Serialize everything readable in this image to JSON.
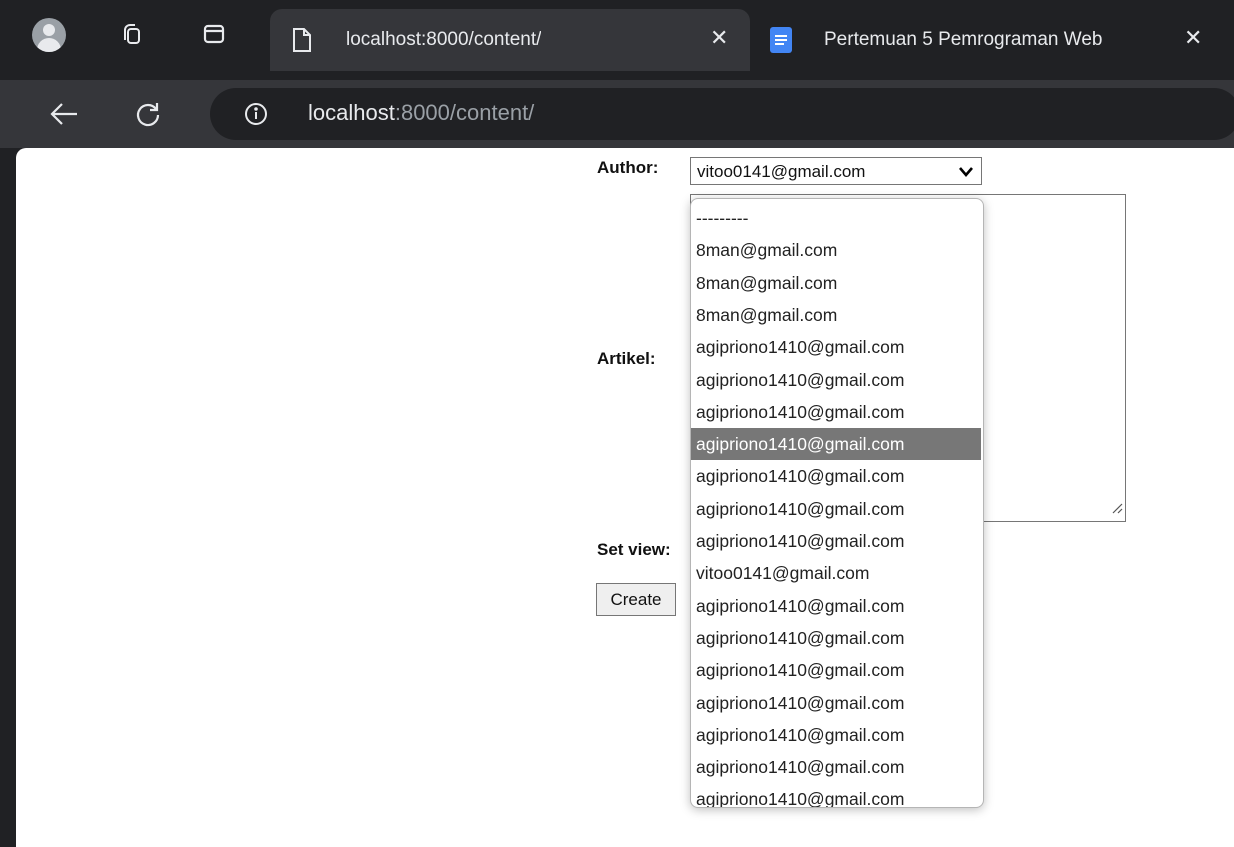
{
  "browser": {
    "active_tab_title": "localhost:8000/content/",
    "inactive_tab_title": "Pertemuan 5 Pemrograman Web",
    "url_host": "localhost",
    "url_rest": ":8000/content/"
  },
  "form": {
    "author_label": "Author:",
    "author_selected": "vitoo0141@gmail.com",
    "artikel_label": "Artikel:",
    "set_view_label": "Set view:",
    "create_label": "Create"
  },
  "dropdown": {
    "highlighted_index": 7,
    "options": [
      "---------",
      "8man@gmail.com",
      "8man@gmail.com",
      "8man@gmail.com",
      "agipriono1410@gmail.com",
      "agipriono1410@gmail.com",
      "agipriono1410@gmail.com",
      "agipriono1410@gmail.com",
      "agipriono1410@gmail.com",
      "agipriono1410@gmail.com",
      "agipriono1410@gmail.com",
      "vitoo0141@gmail.com",
      "agipriono1410@gmail.com",
      "agipriono1410@gmail.com",
      "agipriono1410@gmail.com",
      "agipriono1410@gmail.com",
      "agipriono1410@gmail.com",
      "agipriono1410@gmail.com",
      "agipriono1410@gmail.com"
    ]
  },
  "icons": {
    "profile": "profile-avatar-icon",
    "workspaces": "workspaces-icon",
    "tab_actions": "tab-actions-icon",
    "page": "page-icon",
    "docs": "google-docs-icon",
    "close": "close-icon",
    "back": "back-arrow-icon",
    "reload": "reload-icon",
    "info": "info-icon",
    "chevron": "chevron-down-icon",
    "resize": "resize-grip-icon"
  },
  "colors": {
    "chrome_dark": "#202124",
    "toolbar": "#35363a",
    "docs_blue": "#4285f4",
    "highlight": "#777777"
  }
}
